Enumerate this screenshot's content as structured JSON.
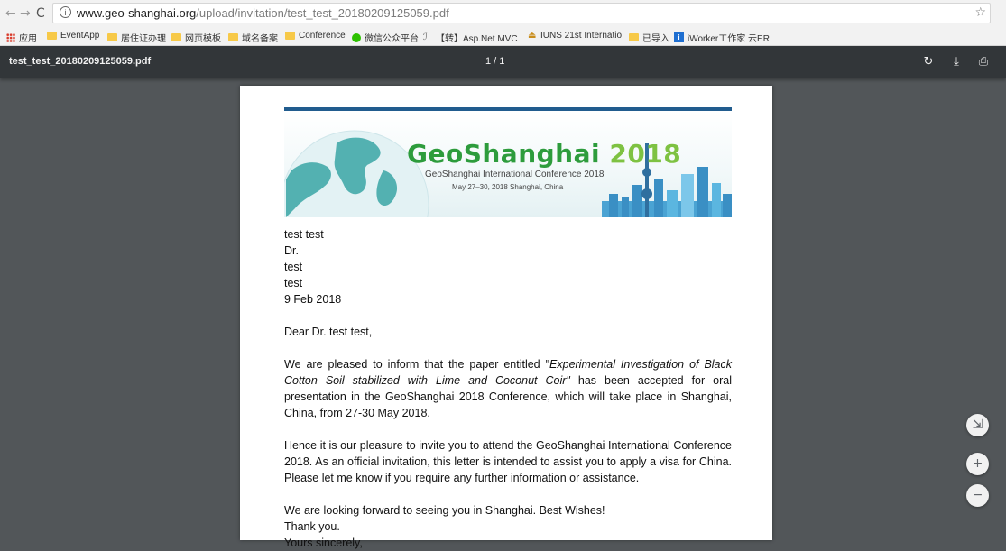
{
  "browser": {
    "nav": {
      "back": "←",
      "forward": "→",
      "reload": "C"
    },
    "address": {
      "info_glyph": "i",
      "host": "www.geo-shanghai.org",
      "path": "/upload/invitation/test_test_20180209125059.pdf",
      "bookmark_star": "☆"
    },
    "bookmarks": [
      {
        "label": "应用",
        "icon": "apps-icon"
      },
      {
        "label": "EventApp",
        "icon": "folder-icon"
      },
      {
        "label": "居住证办理",
        "icon": "folder-icon"
      },
      {
        "label": "网页模板",
        "icon": "folder-icon"
      },
      {
        "label": "域名备案",
        "icon": "folder-icon"
      },
      {
        "label": "Conference",
        "icon": "folder-icon"
      },
      {
        "label": "微信公众平台",
        "icon": "wechat-icon"
      },
      {
        "label": "【转】Asp.Net MVC",
        "icon": "link-icon"
      },
      {
        "label": "IUNS 21st Internatio",
        "icon": "iuns-icon"
      },
      {
        "label": "已导入",
        "icon": "folder-icon"
      },
      {
        "label": "iWorker工作家 云ER",
        "icon": "iworker-icon"
      }
    ]
  },
  "pdf_toolbar": {
    "filename": "test_test_20180209125059.pdf",
    "page_indicator": "1 / 1",
    "rotate_glyph": "↻",
    "download_glyph": "⤓",
    "print_glyph": "⎙"
  },
  "document": {
    "banner": {
      "title_part1": "GeoShanghai",
      "title_part2": " 2018",
      "subtitle": "GeoShanghai International Conference 2018",
      "date_line": "May 27–30, 2018   Shanghai,  China"
    },
    "header_lines": [
      "test test",
      "Dr.",
      "test",
      "test",
      "9 Feb 2018"
    ],
    "salutation": "Dear Dr. test test,",
    "para1_before": "We are pleased to inform that the paper entitled \"",
    "para1_title": "Experimental Investigation of Black Cotton Soil stabilized with Lime and Coconut Coir\"",
    "para1_after": " has been accepted for oral presentation in the GeoShanghai 2018 Conference, which will take place in Shanghai, China, from 27-30 May 2018.",
    "para2": "Hence it is our pleasure to invite you to attend the GeoShanghai International Conference 2018. As an official invitation, this letter is intended to assist you to apply a visa for China. Please let me know if you require any further information or assistance.",
    "para3_line1": "We are looking forward to seeing you in Shanghai. Best Wishes!",
    "para3_line2": "Thank you.",
    "para3_line3": "Yours sincerely,"
  },
  "zoom_controls": {
    "fit": "⇲",
    "zoom_in": "+",
    "zoom_out": "−"
  }
}
